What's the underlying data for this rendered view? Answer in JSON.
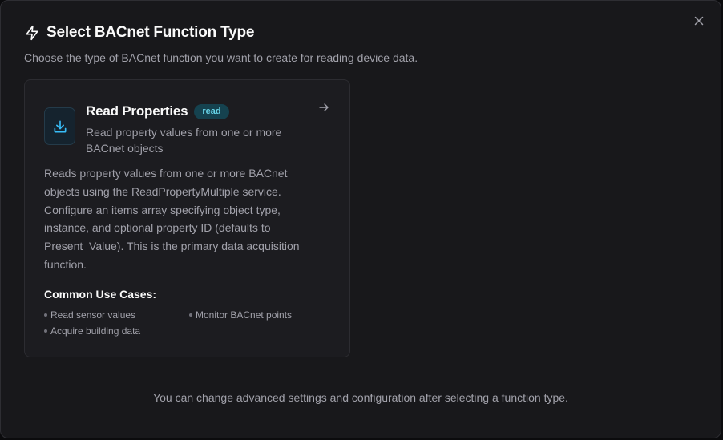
{
  "dialog": {
    "title": "Select BACnet Function Type",
    "subtitle": "Choose the type of BACnet function you want to create for reading device data.",
    "footer": "You can change advanced settings and configuration after selecting a function type."
  },
  "icons": {
    "title": "lightning-icon",
    "close": "close-icon",
    "card": "download-icon",
    "arrow": "arrow-right-icon"
  },
  "colors": {
    "accent": "#38bdf8",
    "badge_bg": "#15424f",
    "badge_text": "#67d4e8"
  },
  "cards": [
    {
      "title": "Read Properties",
      "badge": "read",
      "short_description": "Read property values from one or more BACnet objects",
      "long_description": "Reads property values from one or more BACnet objects using the ReadPropertyMultiple service. Configure an items array specifying object type, instance, and optional property ID (defaults to Present_Value). This is the primary data acquisition function.",
      "use_cases_title": "Common Use Cases:",
      "use_cases": [
        "Read sensor values",
        "Monitor BACnet points",
        "Acquire building data"
      ]
    }
  ]
}
